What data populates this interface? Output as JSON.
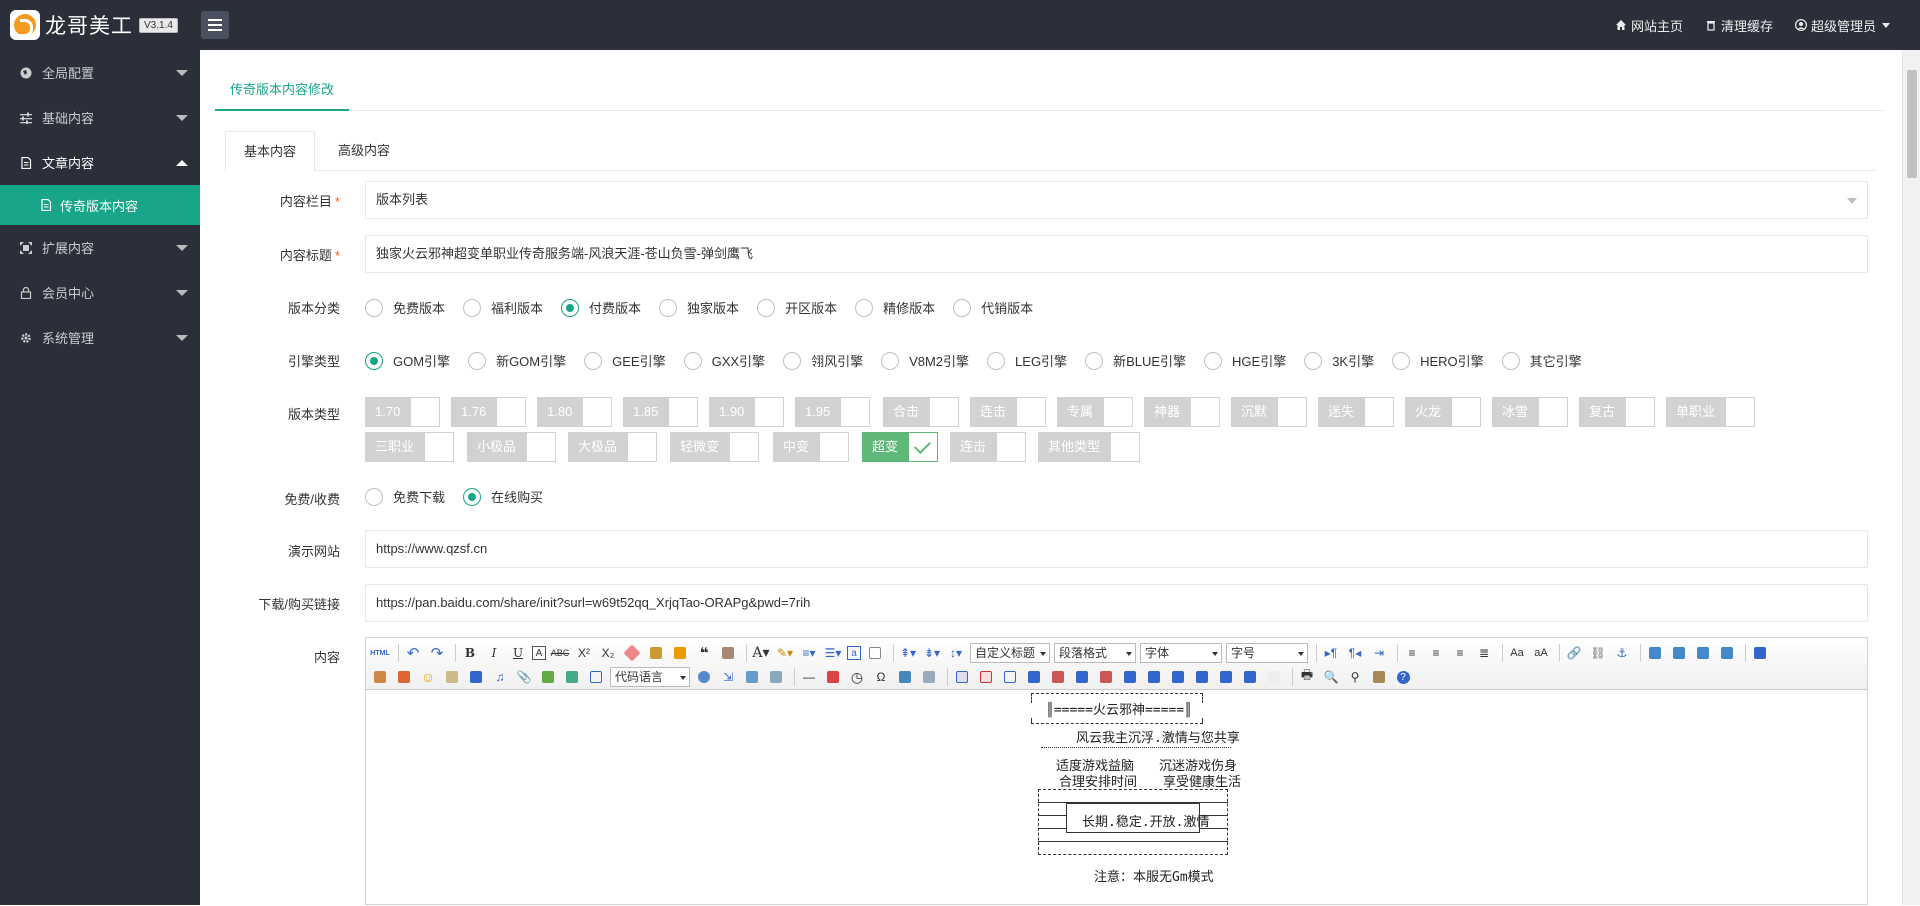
{
  "app": {
    "name": "龙哥美工",
    "version": "V3.1.4"
  },
  "topnav": [
    {
      "label": "网站主页",
      "icon": "home-icon"
    },
    {
      "label": "清理缓存",
      "icon": "trash-icon"
    },
    {
      "label": "超级管理员",
      "icon": "user-icon"
    }
  ],
  "sidebar": {
    "items": [
      {
        "label": "全局配置",
        "icon": "globe-icon"
      },
      {
        "label": "基础内容",
        "icon": "sliders-icon"
      },
      {
        "label": "文章内容",
        "icon": "document-icon"
      },
      {
        "label": "扩展内容",
        "icon": "expand-icon"
      },
      {
        "label": "会员中心",
        "icon": "lock-icon"
      },
      {
        "label": "系统管理",
        "icon": "gear-icon"
      }
    ],
    "active_sub": "传奇版本内容"
  },
  "page": {
    "tab_title": "传奇版本内容修改",
    "tabs": [
      "基本内容",
      "高级内容"
    ]
  },
  "form": {
    "column": {
      "label": "内容栏目",
      "value": "版本列表"
    },
    "title": {
      "label": "内容标题",
      "value": "独家火云邪神超变单职业传奇服务端-风浪天涯-苍山负雪-弹剑鹰飞"
    },
    "version_category": {
      "label": "版本分类",
      "options": [
        "免费版本",
        "福利版本",
        "付费版本",
        "独家版本",
        "开区版本",
        "精修版本",
        "代销版本"
      ],
      "selected": "付费版本"
    },
    "engine_type": {
      "label": "引擎类型",
      "options": [
        "GOM引擎",
        "新GOM引擎",
        "GEE引擎",
        "GXX引擎",
        "翎风引擎",
        "V8M2引擎",
        "LEG引擎",
        "新BLUE引擎",
        "HGE引擎",
        "3K引擎",
        "HERO引擎",
        "其它引擎"
      ],
      "selected": "GOM引擎"
    },
    "version_type": {
      "label": "版本类型",
      "options": [
        "1.70",
        "1.76",
        "1.80",
        "1.85",
        "1.90",
        "1.95",
        "合击",
        "连击",
        "专属",
        "神器",
        "沉默",
        "迷失",
        "火龙",
        "冰雪",
        "复古",
        "单职业",
        "三职业",
        "小极品",
        "大极品",
        "轻微变",
        "中变",
        "超变",
        "连击",
        "其他类型"
      ],
      "checked": [
        "超变"
      ]
    },
    "fee": {
      "label": "免费/收费",
      "options": [
        "免费下载",
        "在线购买"
      ],
      "selected": "在线购买"
    },
    "demo_site": {
      "label": "演示网站",
      "value": "https://www.qzsf.cn"
    },
    "download_link": {
      "label": "下载/购买链接",
      "value": "https://pan.baidu.com/share/init?surl=w69t52qq_XrjqTao-ORAPg&pwd=7rih"
    },
    "content": {
      "label": "内容"
    }
  },
  "editor": {
    "selects": {
      "custom_heading": "自定义标题",
      "paragraph_format": "段落格式",
      "font_family": "字体",
      "font_size": "字号",
      "code_language": "代码语言"
    },
    "body": {
      "banner_title": "║=====火云邪神=====║",
      "slogan": "风云我主沉浮.激情与您共享",
      "advice_left_1": "适度游戏益脑",
      "advice_left_2": "合理安排时间",
      "advice_right_1": "沉迷游戏伤身",
      "advice_right_2": "享受健康生活",
      "motto": "长期.稳定.开放.激情",
      "notice": "注意：本服无Gm模式"
    }
  },
  "colors": {
    "accent": "#18a689",
    "sidebar_bg": "#2b2f3a",
    "chip_on": "#5fb878",
    "chip_off": "#d2d2d2"
  }
}
